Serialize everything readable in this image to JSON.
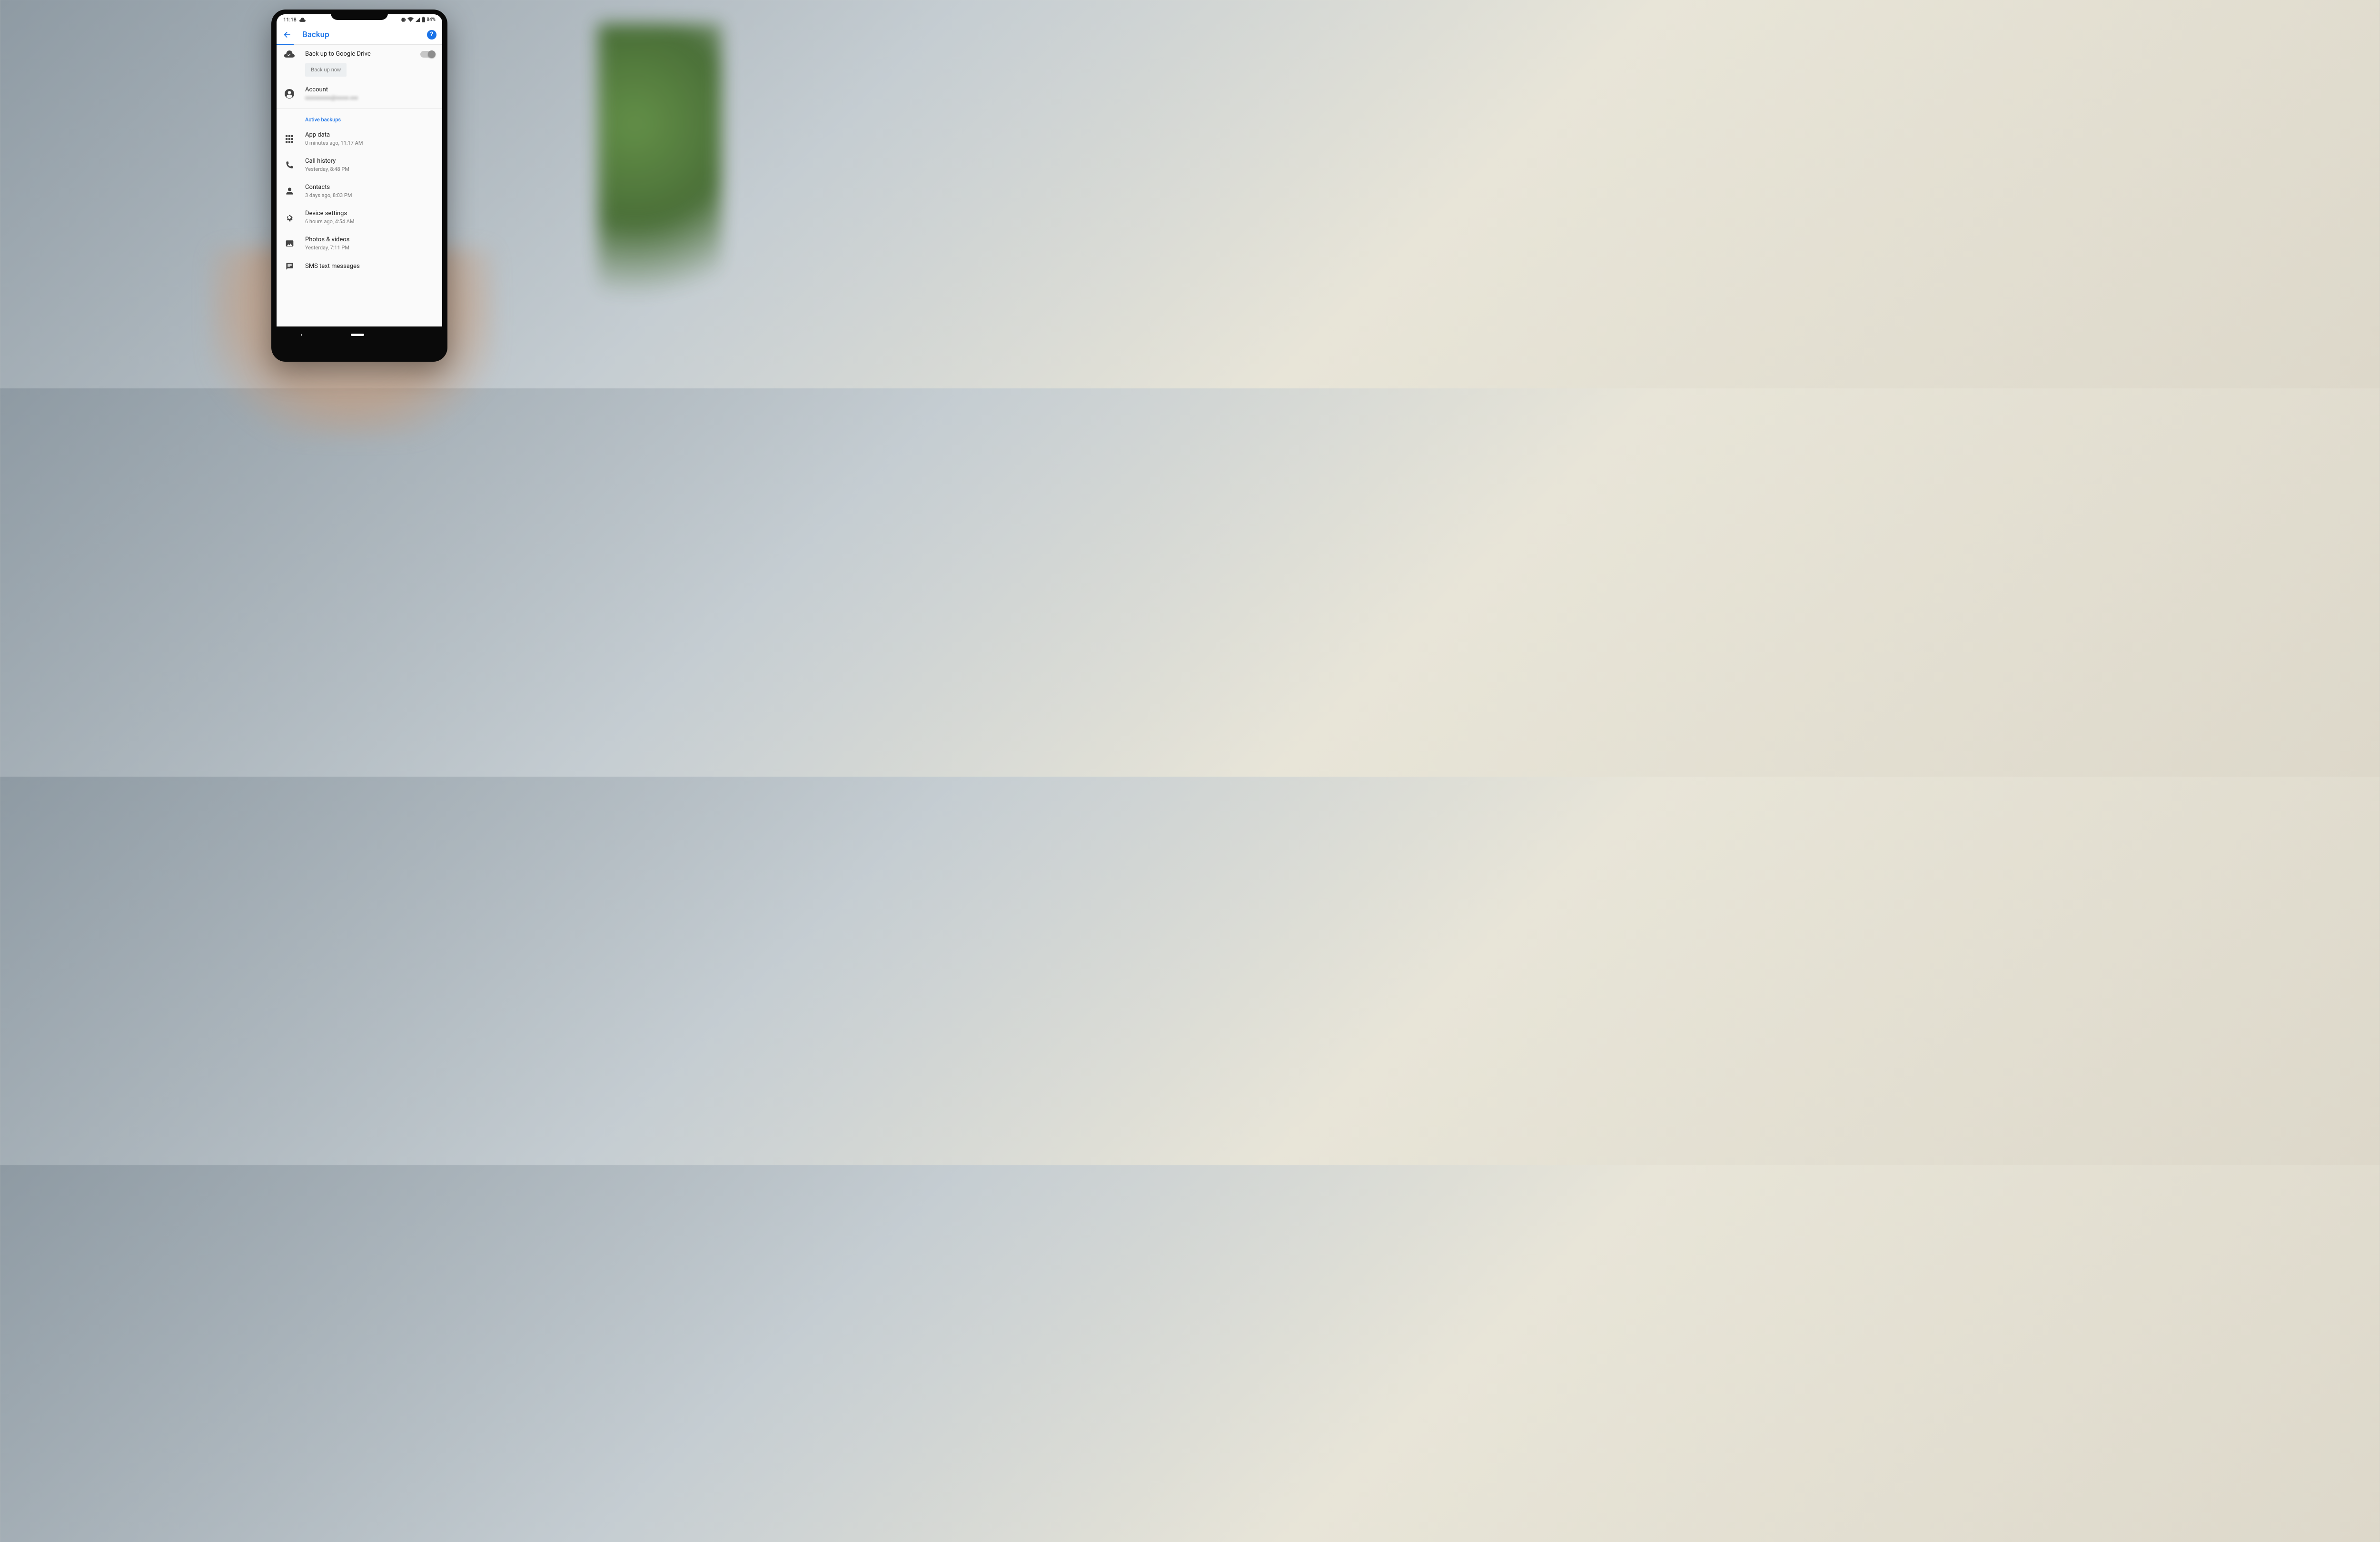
{
  "status": {
    "time": "11:18",
    "battery": "84%"
  },
  "header": {
    "title": "Backup"
  },
  "backup_toggle": {
    "label": "Back up to Google Drive"
  },
  "backup_button": {
    "label": "Back up now"
  },
  "account": {
    "label": "Account"
  },
  "section": {
    "active_backups": "Active backups"
  },
  "items": [
    {
      "title": "App data",
      "subtitle": "0 minutes ago, 11:17 AM"
    },
    {
      "title": "Call history",
      "subtitle": "Yesterday, 8:48 PM"
    },
    {
      "title": "Contacts",
      "subtitle": "3 days ago, 8:03 PM"
    },
    {
      "title": "Device settings",
      "subtitle": "6 hours ago, 4:54 AM"
    },
    {
      "title": "Photos & videos",
      "subtitle": "Yesterday, 7:11 PM"
    },
    {
      "title": "SMS text messages",
      "subtitle": ""
    }
  ]
}
